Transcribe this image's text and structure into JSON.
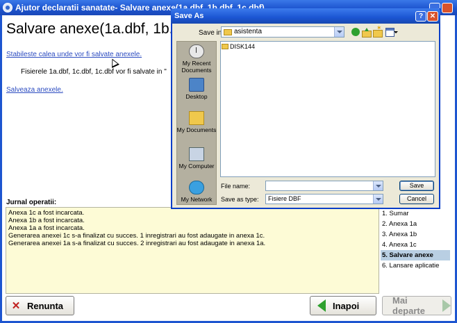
{
  "window": {
    "title": "Ajutor declaratii sanatate- Salvare anexe(1a.dbf, 1b.dbf, 1c.dbf)"
  },
  "main": {
    "heading": "Salvare anexe(1a.dbf, 1b.dbf",
    "link_path": "Stabileste calea unde vor fi salvate anexele.",
    "info_files": "Fisierele 1a.dbf, 1c.dbf, 1c.dbf vor fi salvate in \"",
    "link_save": "Salveaza anexele."
  },
  "log": {
    "label": "Jurnal operatii:",
    "lines": [
      "Anexa 1c a fost incarcata.",
      "Anexa 1b a fost incarcata.",
      "Anexa 1a a fost incarcata.",
      "Generarea anexei 1c s-a finalizat cu succes. 1 inregistrari au fost adaugate in anexa 1c.",
      "Generarea anexei 1a s-a finalizat cu succes. 2 inregistrari au fost adaugate in anexa 1a."
    ]
  },
  "steps": [
    {
      "label": "1. Sumar",
      "active": false
    },
    {
      "label": "2. Anexa 1a",
      "active": false
    },
    {
      "label": "3. Anexa 1b",
      "active": false
    },
    {
      "label": "4. Anexa 1c",
      "active": false
    },
    {
      "label": "5. Salvare anexe",
      "active": true
    },
    {
      "label": "6. Lansare aplicatie",
      "active": false
    }
  ],
  "buttons": {
    "cancel": "Renunta",
    "back": "Inapoi",
    "next": "Mai departe"
  },
  "dialog": {
    "title": "Save As",
    "help_glyph": "?",
    "close_glyph": "✕",
    "save_in_label": "Save in:",
    "save_in_value": "asistenta",
    "places": {
      "recent": "My Recent Documents",
      "desktop": "Desktop",
      "documents": "My Documents",
      "computer": "My Computer",
      "network": "My Network"
    },
    "files": [
      "DISK144"
    ],
    "file_name_label": "File name:",
    "file_name_value": "",
    "save_as_type_label": "Save as type:",
    "save_as_type_value": "Fisiere DBF",
    "save_button": "Save",
    "cancel_button": "Cancel"
  },
  "colors": {
    "titlebar": "#1d55d0",
    "link": "#2b4bc0",
    "log_background": "#fdfbd6",
    "active_step": "#b9cfe3"
  }
}
